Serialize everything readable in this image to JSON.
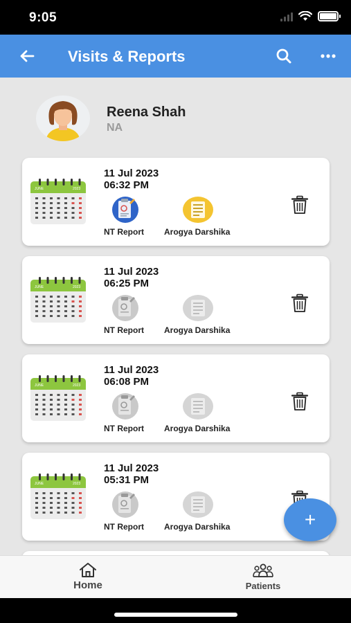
{
  "status_bar": {
    "time": "9:05"
  },
  "header": {
    "title": "Visits & Reports"
  },
  "profile": {
    "name": "Reena Shah",
    "subtitle": "NA"
  },
  "calendar": {
    "month": "JUNE",
    "year": "2023"
  },
  "visits": [
    {
      "date": "11 Jul 2023",
      "time": "06:32 PM",
      "docs": [
        "NT Report",
        "Arogya Darshika"
      ],
      "docs_active": true
    },
    {
      "date": "11 Jul 2023",
      "time": "06:25 PM",
      "docs": [
        "NT Report",
        "Arogya Darshika"
      ],
      "docs_active": false
    },
    {
      "date": "11 Jul 2023",
      "time": "06:08 PM",
      "docs": [
        "NT Report",
        "Arogya Darshika"
      ],
      "docs_active": false
    },
    {
      "date": "11 Jul 2023",
      "time": "05:31 PM",
      "docs": [
        "NT Report",
        "Arogya Darshika"
      ],
      "docs_active": false
    }
  ],
  "fab": {
    "label": "+"
  },
  "bottom_nav": {
    "home": "Home",
    "patients": "Patients"
  },
  "colors": {
    "primary": "#4a90e2",
    "calendar_header": "#8dc63f",
    "background": "#e6e6e6"
  }
}
